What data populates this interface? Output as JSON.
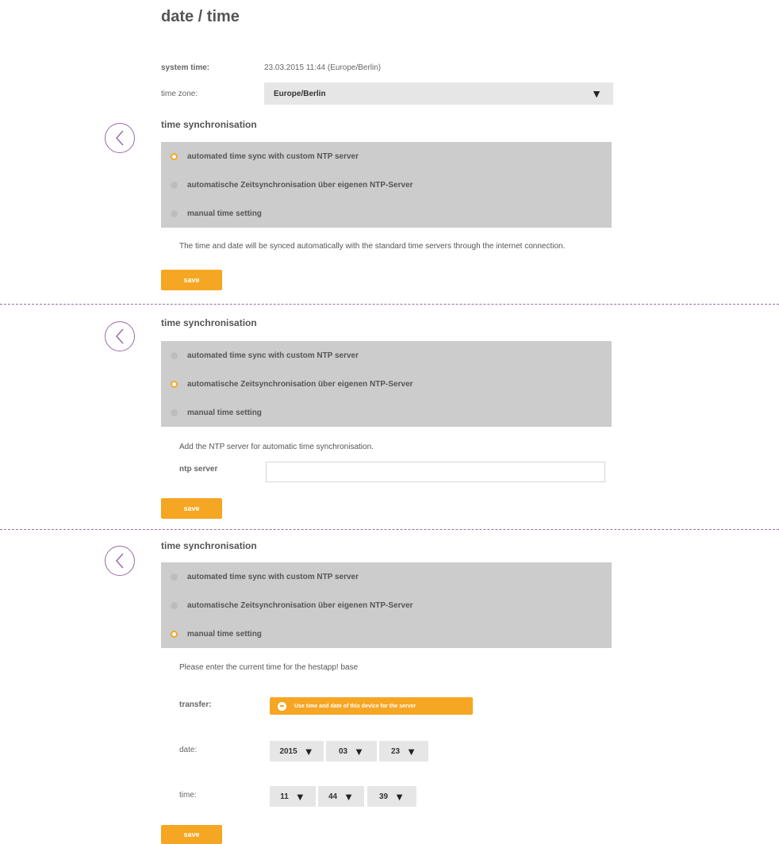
{
  "page": {
    "title": "date / time"
  },
  "system_time": {
    "label": "system time:",
    "value": "23.03.2015 11:44 (Europe/Berlin)"
  },
  "time_zone": {
    "label": "time zone:",
    "value": "Europe/Berlin",
    "caret": "▼"
  },
  "sync_options": [
    "automated time sync with custom NTP server",
    "automatische Zeitsynchronisation über eigenen NTP-Server",
    "manual time setting"
  ],
  "panels": [
    {
      "heading": "time synchronisation",
      "selected_index": 0,
      "info": "The time and date will be synced automatically with the standard time servers through the internet connection.",
      "save_label": "save"
    },
    {
      "heading": "time synchronisation",
      "selected_index": 1,
      "info": "Add the NTP server for automatic time synchronisation.",
      "ntp_label": "ntp server",
      "ntp_value": "",
      "save_label": "save"
    },
    {
      "heading": "time synchronisation",
      "selected_index": 2,
      "info": "Please enter the current time for the hestapp! base",
      "transfer_label": "transfer:",
      "transfer_button": "Use time and date of this device for the server",
      "date_label": "date:",
      "date": {
        "year": "2015",
        "month": "03",
        "day": "23"
      },
      "time_label": "time:",
      "time": {
        "hour": "11",
        "minute": "44",
        "second": "39"
      },
      "save_label": "save"
    }
  ],
  "icons": {
    "back": "chevron-left-circle-icon",
    "dropdown": "caret-down-icon",
    "transfer": "minus-circle-icon"
  },
  "colors": {
    "accent": "#f5a623",
    "divider": "#9b6aa8",
    "radio_group_bg": "#cccccc",
    "select_bg": "#e6e6e6"
  }
}
